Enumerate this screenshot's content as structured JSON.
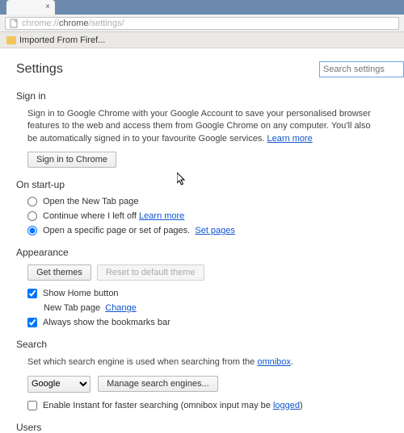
{
  "browser": {
    "url_prefix": "chrome://",
    "url_path_bold": "chrome",
    "url_path_rest": "/settings/",
    "bookmark_folder": "Imported From Firef..."
  },
  "page": {
    "title": "Settings",
    "search_placeholder": "Search settings"
  },
  "signin": {
    "heading": "Sign in",
    "desc": "Sign in to Google Chrome with your Google Account to save your personalised browser features to the web and access them from Google Chrome on any computer. You'll also be automatically signed in to your favourite Google services. ",
    "learn_more": "Learn more",
    "button": "Sign in to Chrome"
  },
  "startup": {
    "heading": "On start-up",
    "opt_newtab": "Open the New Tab page",
    "opt_continue": "Continue where I left off",
    "opt_continue_learn": "Learn more",
    "opt_specific": "Open a specific page or set of pages.",
    "opt_specific_link": "Set pages"
  },
  "appearance": {
    "heading": "Appearance",
    "get_themes": "Get themes",
    "reset_theme": "Reset to default theme",
    "show_home": "Show Home button",
    "new_tab_page": "New Tab page",
    "change": "Change",
    "show_bookmarks": "Always show the bookmarks bar"
  },
  "search": {
    "heading": "Search",
    "desc_prefix": "Set which search engine is used when searching from the ",
    "omnibox_word": "omnibox",
    "engine": "Google",
    "manage": "Manage search engines...",
    "instant_prefix": "Enable Instant for faster searching (omnibox input may be ",
    "instant_link": "logged",
    "instant_suffix": ")"
  },
  "users": {
    "heading": "Users"
  }
}
